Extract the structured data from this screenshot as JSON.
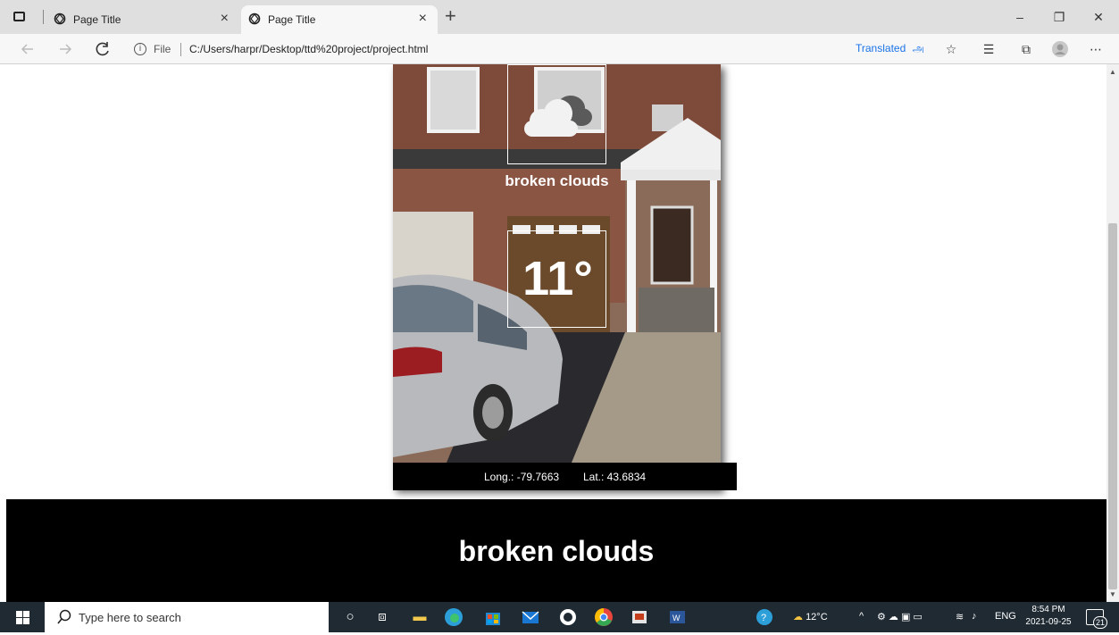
{
  "browser": {
    "tabs": [
      {
        "title": "Page Title",
        "close": "×"
      },
      {
        "title": "Page Title",
        "close": "×"
      }
    ],
    "new_tab": "+",
    "window": {
      "minimize": "–",
      "restore": "❐",
      "close": "✕"
    },
    "address": {
      "scheme_label": "File",
      "url": "C:/Users/harpr/Desktop/ttd%20project/project.html"
    },
    "translated_label": "Translated",
    "translated_glyph": "அ"
  },
  "weather": {
    "description": "broken clouds",
    "temperature": "11°",
    "longitude": "Long.: -79.7663",
    "latitude": "Lat.: 43.6834",
    "banner": "broken clouds",
    "icon": "cloud-icon"
  },
  "taskbar": {
    "search_placeholder": "Type here to search",
    "weather_temp": "12°C",
    "language": "ENG",
    "time": "8:54 PM",
    "date": "2021-09-25",
    "notifications": "21"
  }
}
